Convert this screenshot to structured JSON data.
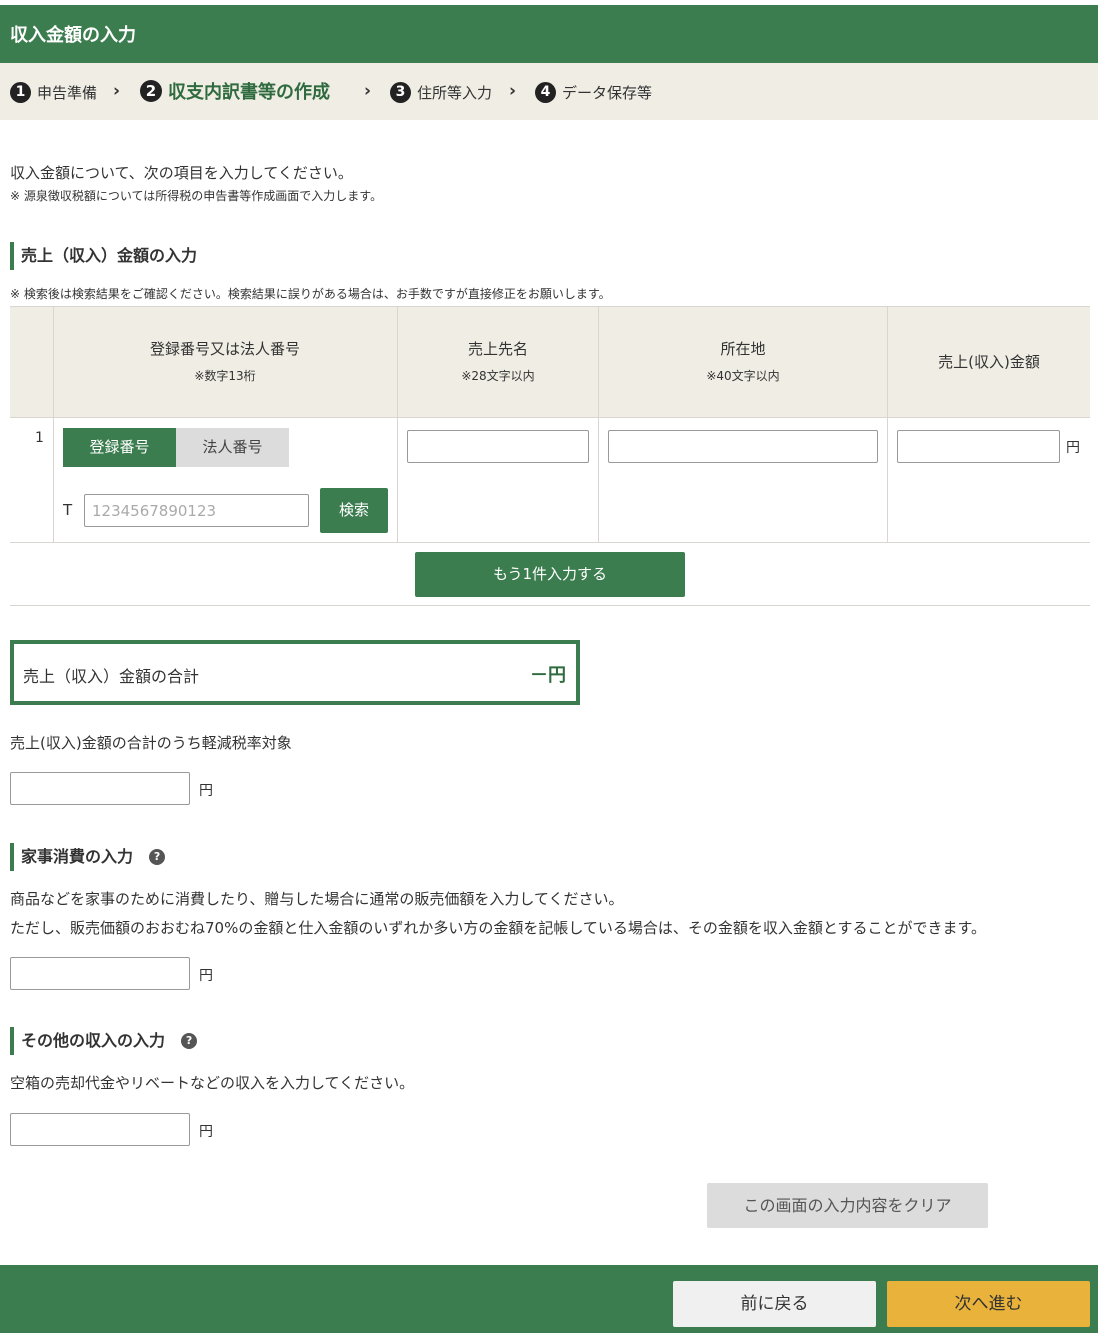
{
  "header": {
    "title": "収入金額の入力"
  },
  "steps": [
    {
      "num": "1",
      "label": "申告準備"
    },
    {
      "num": "2",
      "label": "収支内訳書等の作成"
    },
    {
      "num": "3",
      "label": "住所等入力"
    },
    {
      "num": "4",
      "label": "データ保存等"
    }
  ],
  "intro": {
    "text": "収入金額について、次の項目を入力してください。",
    "note": "※ 源泉徴収税額については所得税の申告書等作成画面で入力します。"
  },
  "sales": {
    "title": "売上（収入）金額の入力",
    "note": "※ 検索後は検索結果をご確認ください。検索結果に誤りがある場合は、お手数ですが直接修正をお願いします。",
    "columns": [
      {
        "label": "登録番号又は法人番号",
        "sub": "※数字13桁"
      },
      {
        "label": "売上先名",
        "sub": "※28文字以内"
      },
      {
        "label": "所在地",
        "sub": "※40文字以内"
      },
      {
        "label": "売上(収入)金額",
        "sub": ""
      }
    ],
    "row": {
      "num": "1",
      "tab_registration": "登録番号",
      "tab_corporate": "法人番号",
      "prefix": "T",
      "number_placeholder": "1234567890123",
      "search_label": "検索",
      "yen": "円"
    },
    "add_row_label": "もう1件入力する"
  },
  "total": {
    "label": "売上（収入）金額の合計",
    "value": "－円"
  },
  "reduced": {
    "label": "売上(収入)金額の合計のうち軽減税率対象",
    "yen": "円"
  },
  "household": {
    "title": "家事消費の入力",
    "help": "?",
    "desc1": "商品などを家事のために消費したり、贈与した場合に通常の販売価額を入力してください。",
    "desc2": "ただし、販売価額のおおむね70%の金額と仕入金額のいずれか多い方の金額を記帳している場合は、その金額を収入金額とすることができます。",
    "yen": "円"
  },
  "other": {
    "title": "その他の収入の入力",
    "help": "?",
    "desc": "空箱の売却代金やリベートなどの収入を入力してください。",
    "yen": "円"
  },
  "actions": {
    "clear_label": "この画面の入力内容をクリア",
    "back_label": "前に戻る",
    "next_label": "次へ進む"
  }
}
